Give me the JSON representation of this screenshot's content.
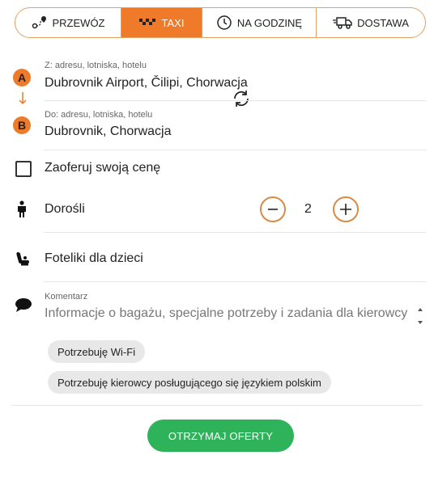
{
  "tabs": [
    {
      "label": "PRZEWÓZ",
      "icon": "route-icon",
      "active": false
    },
    {
      "label": "TAXI",
      "icon": "taxi-icon",
      "active": true
    },
    {
      "label": "NA GODZINĘ",
      "icon": "clock-icon",
      "active": false
    },
    {
      "label": "DOSTAWA",
      "icon": "truck-icon",
      "active": false
    }
  ],
  "from": {
    "marker": "A",
    "label": "Z: adresu, lotniska, hotelu",
    "value": "Dubrovnik Airport, Čilipi, Chorwacja"
  },
  "to": {
    "marker": "B",
    "label": "Do: adresu, lotniska, hotelu",
    "value": "Dubrovnik, Chorwacja"
  },
  "offer_price": {
    "label": "Zaoferuj swoją cenę"
  },
  "adults": {
    "label": "Dorośli",
    "count": "2"
  },
  "child_seats": {
    "label": "Foteliki dla dzieci"
  },
  "comment": {
    "label": "Komentarz",
    "placeholder": "Informacje o bagażu, specjalne potrzeby i zadania dla kierowcy"
  },
  "chips": [
    "Potrzebuję Wi-Fi",
    "Potrzebuję kierowcy posługującego się językiem polskim"
  ],
  "submit": {
    "label": "OTRZYMAJ OFERTY"
  },
  "colors": {
    "accent": "#ee7a2a",
    "submit": "#2fb35a",
    "chip_bg": "#e8e8e8"
  }
}
